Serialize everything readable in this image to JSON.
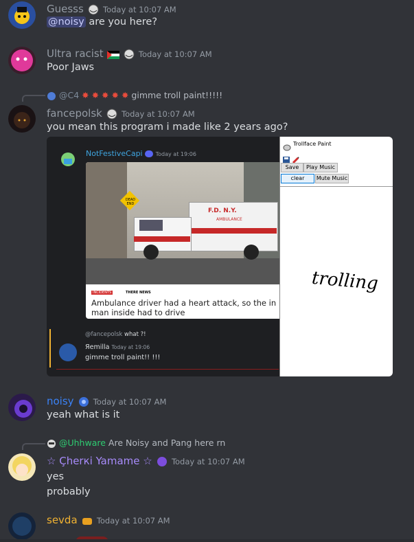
{
  "messages": [
    {
      "username": "Guesss",
      "timestamp": "Today at 10:07 AM",
      "mention": "@noisy",
      "text": " are you here?",
      "name_color": "#949ba4"
    },
    {
      "username": "Ultra racist",
      "timestamp": "Today at 10:07 AM",
      "text": "Poor Jaws",
      "name_color": "#949ba4"
    },
    {
      "reply_user": "@C4",
      "reply_text": "gimme troll paint!!!!!",
      "username": "fancepolsk",
      "timestamp": "Today at 10:07 AM",
      "text": "you mean this program i made like 2 years ago?",
      "name_color": "#949ba4"
    },
    {
      "username": "noisy",
      "timestamp": "Today at 10:07 AM",
      "text": "yeah what is it",
      "name_color": "#3b82f6"
    },
    {
      "reply_user": "@Uhhware",
      "reply_text": "Are Noisy and Pang here rn",
      "username": "☆ Çherкi Yamame ☆",
      "timestamp": "Today at 10:07 AM",
      "lines": [
        "yes",
        "probably"
      ],
      "name_color": "#a78bfa"
    },
    {
      "username": "sevda",
      "timestamp": "Today at 10:07 AM",
      "name_color": "#f0b232"
    }
  ],
  "screenshot": {
    "inner_username": "NotFestiveCapi",
    "inner_timestamp": "Today at 19:06",
    "dead_end": "DEAD END",
    "news_tag": "INCIDENTS",
    "news_source": "THERE NEWS",
    "news_headline_1": "Ambulance driver had a heart attack, so the in",
    "news_headline_2": "man inside had to drive",
    "truck_text": "F.D. N.Y.",
    "truck_sub": "AMBULANCE",
    "reply_ref": "@fancepolsk",
    "reply_ref_text": "what ?!",
    "reply_user": "Яemilla",
    "reply_ts": "Today at 19:06",
    "reply_msg": "gimme troll paint!! !!!"
  },
  "paint_app": {
    "title": "Trollface Paint",
    "save": "Save",
    "play_music": "Play Music",
    "clear": "clear",
    "mute_music": "Mute Music",
    "canvas_text": "trolling"
  },
  "colors": {
    "bg": "#313338",
    "accent_mention": "#3c4270"
  }
}
